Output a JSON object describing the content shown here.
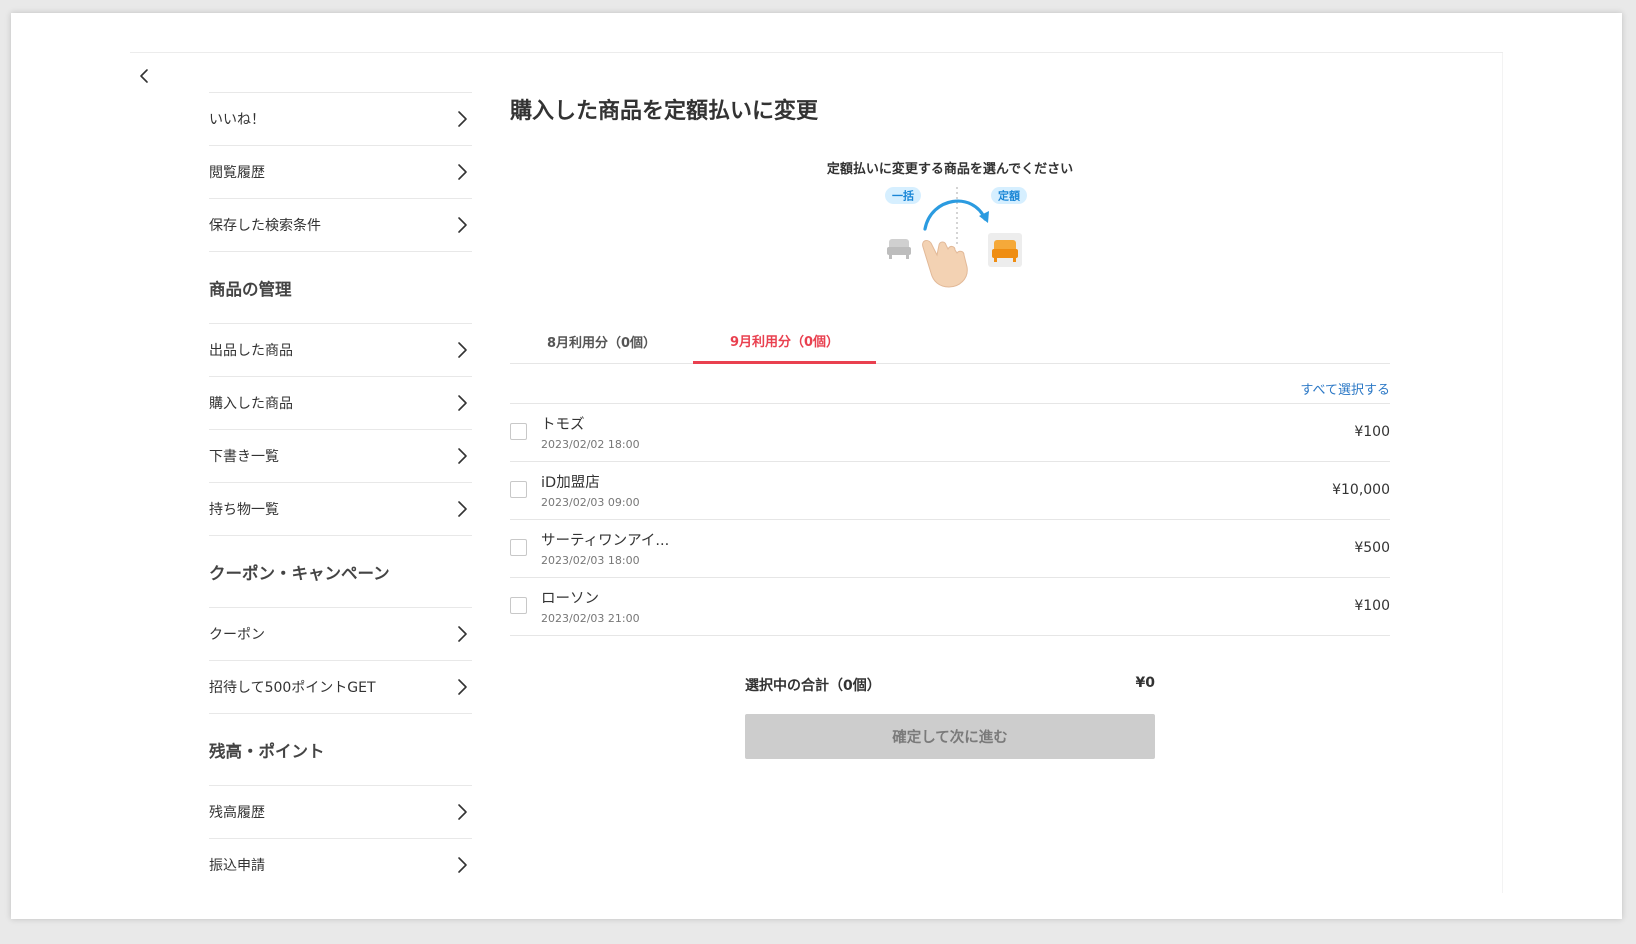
{
  "page_title": "購入した商品を定額払いに変更",
  "instruction": "定額払いに変更する商品を選んでください",
  "illustration": {
    "left_badge": "一括",
    "right_badge": "定額",
    "colors": {
      "badge_bg": "#d6efff",
      "badge_text": "#1a86d6",
      "arrow": "#2b9be0",
      "seat_gray": "#cfcfcf",
      "seat_orange": "#f39a1e",
      "hand": "#f3d2b3"
    }
  },
  "sidebar": {
    "group1": [
      {
        "label": "いいね！"
      },
      {
        "label": "閲覧履歴"
      },
      {
        "label": "保存した検索条件"
      }
    ],
    "section2_title": "商品の管理",
    "group2": [
      {
        "label": "出品した商品"
      },
      {
        "label": "購入した商品"
      },
      {
        "label": "下書き一覧"
      },
      {
        "label": "持ち物一覧"
      }
    ],
    "section3_title": "クーポン・キャンペーン",
    "group3": [
      {
        "label": "クーポン"
      },
      {
        "label": "招待して500ポイントGET"
      }
    ],
    "section4_title": "残高・ポイント",
    "group4": [
      {
        "label": "残高履歴"
      },
      {
        "label": "振込申請"
      }
    ]
  },
  "tabs": [
    {
      "label": "8月利用分（0個）",
      "active": false
    },
    {
      "label": "9月利用分（0個）",
      "active": true
    }
  ],
  "select_all_label": "すべて選択する",
  "items": [
    {
      "name": "トモズ",
      "date": "2023/02/02 18:00",
      "amount": "¥100"
    },
    {
      "name": "iD加盟店",
      "date": "2023/02/03 09:00",
      "amount": "¥10,000"
    },
    {
      "name": "サーティワンアイ...",
      "date": "2023/02/03 18:00",
      "amount": "¥500"
    },
    {
      "name": "ローソン",
      "date": "2023/02/03 21:00",
      "amount": "¥100"
    }
  ],
  "summary": {
    "label": "選択中の合計（0個）",
    "value": "¥0"
  },
  "confirm_label": "確定して次に進む",
  "colors": {
    "accent": "#e9404f",
    "link": "#2b78c6",
    "disabled_button_bg": "#cdcdcd"
  }
}
